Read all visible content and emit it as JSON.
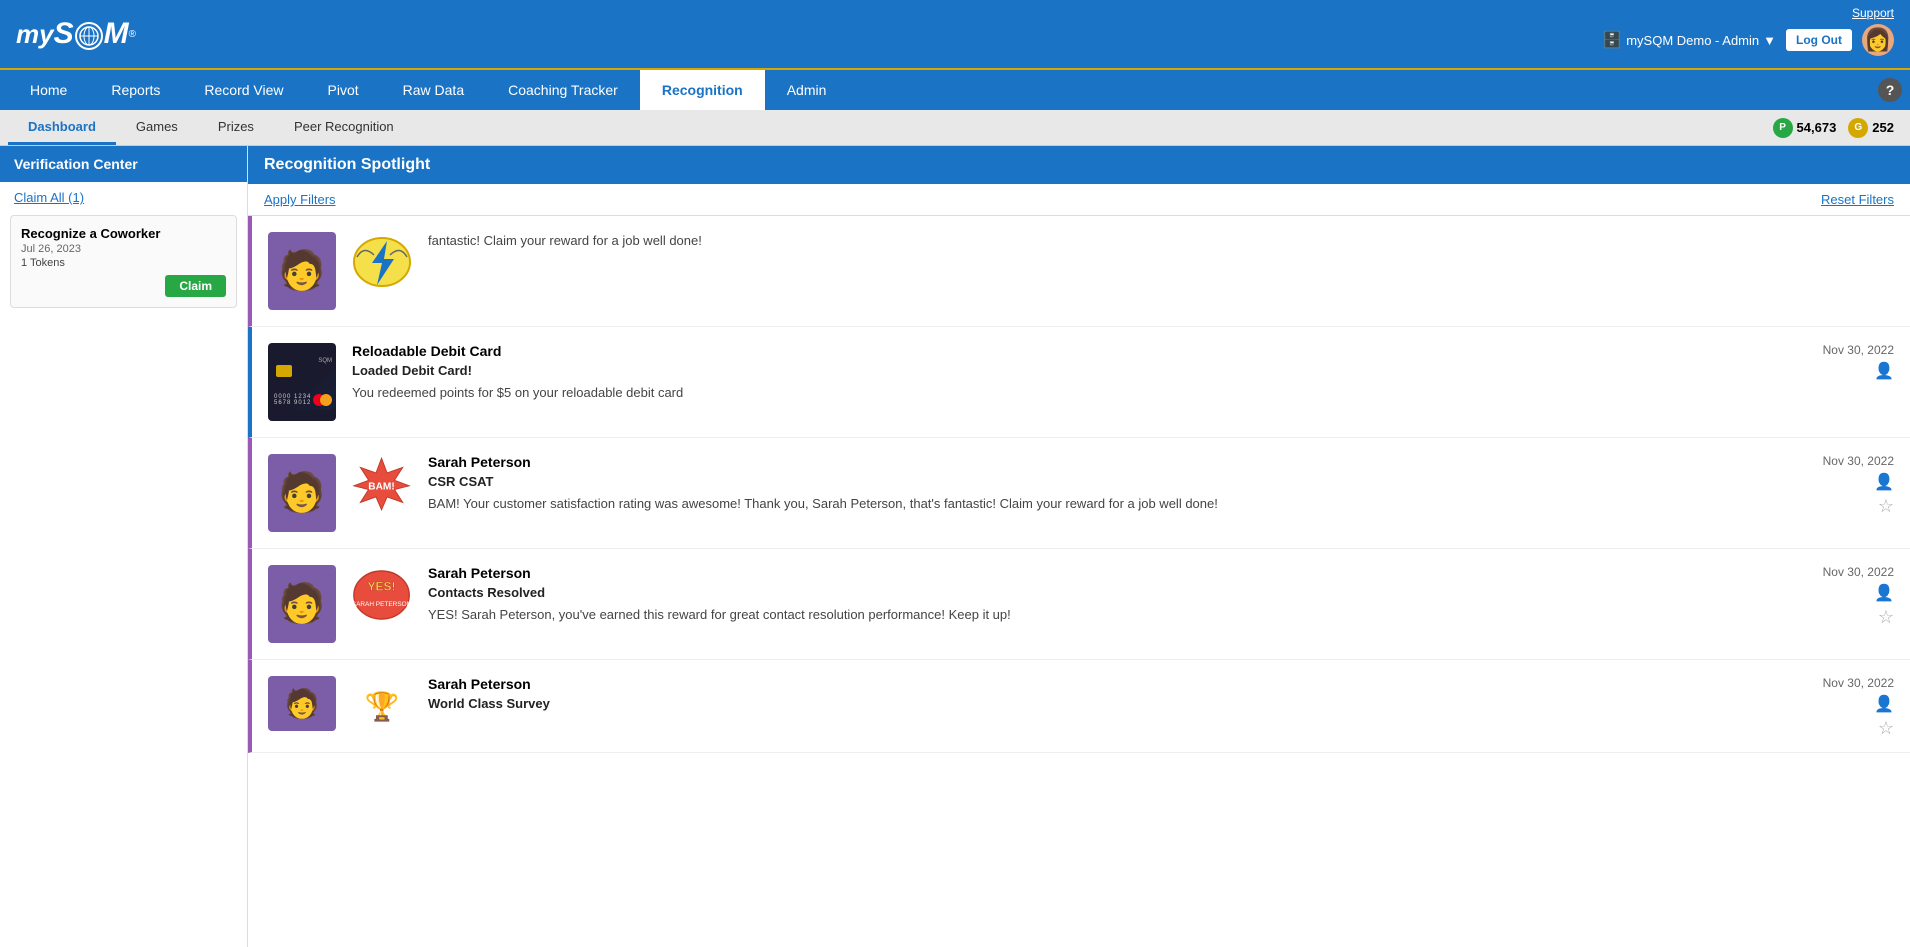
{
  "topBar": {
    "logoText": "my",
    "logoSQM": "SQM",
    "supportLabel": "Support",
    "userLabel": "mySQM Demo - Admin",
    "logoutLabel": "Log Out"
  },
  "nav": {
    "items": [
      {
        "id": "home",
        "label": "Home",
        "active": false
      },
      {
        "id": "reports",
        "label": "Reports",
        "active": false
      },
      {
        "id": "record-view",
        "label": "Record View",
        "active": false
      },
      {
        "id": "pivot",
        "label": "Pivot",
        "active": false
      },
      {
        "id": "raw-data",
        "label": "Raw Data",
        "active": false
      },
      {
        "id": "coaching-tracker",
        "label": "Coaching Tracker",
        "active": false
      },
      {
        "id": "recognition",
        "label": "Recognition",
        "active": true
      },
      {
        "id": "admin",
        "label": "Admin",
        "active": false
      }
    ]
  },
  "subNav": {
    "items": [
      {
        "id": "dashboard",
        "label": "Dashboard",
        "active": true
      },
      {
        "id": "games",
        "label": "Games",
        "active": false
      },
      {
        "id": "prizes",
        "label": "Prizes",
        "active": false
      },
      {
        "id": "peer-recognition",
        "label": "Peer Recognition",
        "active": false
      }
    ],
    "pointsP": "54,673",
    "pointsG": "252"
  },
  "sidebar": {
    "title": "Verification Center",
    "claimAllLabel": "Claim All (1)",
    "card": {
      "title": "Recognize a Coworker",
      "date": "Jul 26, 2023",
      "tokens": "1 Tokens",
      "claimLabel": "Claim"
    }
  },
  "recognition": {
    "spotlightTitle": "Recognition Spotlight",
    "applyFilters": "Apply Filters",
    "resetFilters": "Reset Filters",
    "items": [
      {
        "id": "item-1",
        "personName": "",
        "title": "",
        "date": "",
        "description": "fantastic! Claim your reward for a job well done!",
        "badgeType": "lightning",
        "borderColor": "purple"
      },
      {
        "id": "item-2",
        "personName": "Reloadable Debit Card",
        "title": "Loaded Debit Card!",
        "date": "Nov 30, 2022",
        "description": "You redeemed points for $5 on your reloadable debit card",
        "badgeType": "debit-card",
        "borderColor": "blue"
      },
      {
        "id": "item-3",
        "personName": "Sarah Peterson",
        "title": "CSR CSAT",
        "date": "Nov 30, 2022",
        "description": "BAM! Your customer satisfaction rating was awesome! Thank you, Sarah Peterson, that's fantastic! Claim your reward for a job well done!",
        "badgeType": "bam",
        "borderColor": "purple"
      },
      {
        "id": "item-4",
        "personName": "Sarah Peterson",
        "title": "Contacts Resolved",
        "date": "Nov 30, 2022",
        "description": "YES! Sarah Peterson, you've earned this reward for great contact resolution performance! Keep it up!",
        "badgeType": "yes",
        "borderColor": "purple"
      },
      {
        "id": "item-5",
        "personName": "Sarah Peterson",
        "title": "World Class Survey",
        "date": "Nov 30, 2022",
        "description": "",
        "badgeType": "trophy",
        "borderColor": "purple"
      }
    ]
  }
}
